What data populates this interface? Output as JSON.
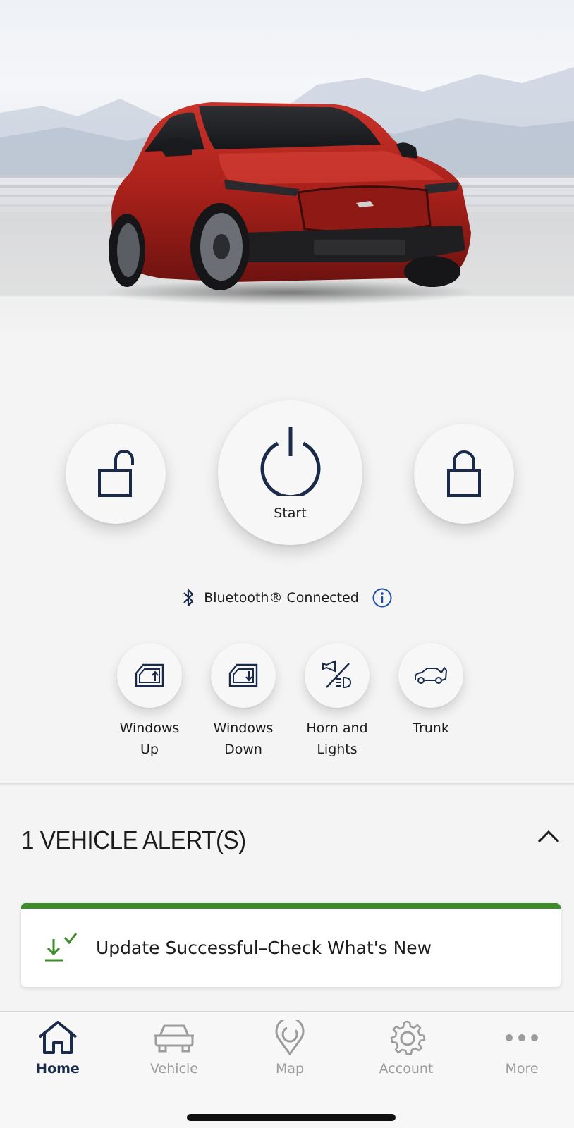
{
  "controls": {
    "start_label": "Start",
    "bluetooth_status": "Bluetooth® Connected"
  },
  "quick_actions": [
    {
      "label": "Windows\nUp",
      "icon": "window-up-icon"
    },
    {
      "label": "Windows\nDown",
      "icon": "window-down-icon"
    },
    {
      "label": "Horn and\nLights",
      "icon": "horn-lights-icon"
    },
    {
      "label": "Trunk",
      "icon": "trunk-icon"
    }
  ],
  "alerts": {
    "title": "1 VEHICLE ALERT(S)",
    "items": [
      {
        "text": "Update Successful–Check What's New",
        "icon": "update-check-icon",
        "accent": "#3d8c2a"
      }
    ]
  },
  "tabs": [
    {
      "label": "Home",
      "icon": "home-icon",
      "active": true
    },
    {
      "label": "Vehicle",
      "icon": "car-icon",
      "active": false
    },
    {
      "label": "Map",
      "icon": "map-pin-icon",
      "active": false
    },
    {
      "label": "Account",
      "icon": "gear-icon",
      "active": false
    },
    {
      "label": "More",
      "icon": "more-dots-icon",
      "active": false
    }
  ],
  "colors": {
    "brand_navy": "#1a2a4a",
    "success_green": "#3d8c2a",
    "inactive_gray": "#9c9c9c",
    "vehicle_red": "#b5221c"
  }
}
